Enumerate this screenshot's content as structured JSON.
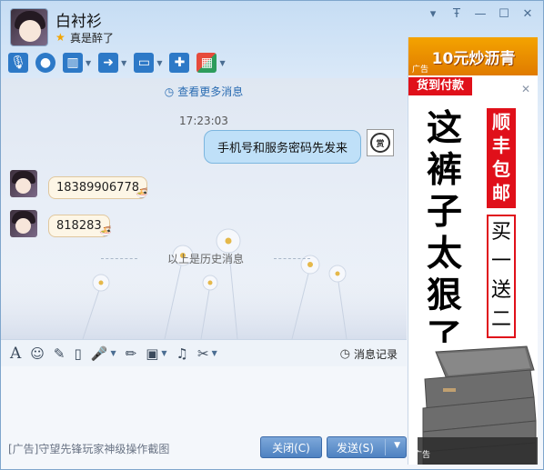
{
  "window": {
    "contact_name": "白衬衫",
    "signature": "真是醉了"
  },
  "toolbar": {
    "items": [
      "microphone",
      "video-camera",
      "presentation",
      "file-transfer",
      "remote-desktop",
      "message",
      "app-grid"
    ]
  },
  "chat": {
    "more_messages": "查看更多消息",
    "timestamp": "17:23:03",
    "outgoing": "手机号和服务密码先发来",
    "incoming": [
      "18389906778",
      "818283"
    ],
    "history_separator": "以上是历史消息"
  },
  "input_toolbar": {
    "history_label": "消息记录"
  },
  "footer": {
    "ad_text": "[广告]守望先锋玩家神级操作截图",
    "close_label": "关闭(C)",
    "send_label": "发送(S)"
  },
  "ad": {
    "banner": "10元炒沥青",
    "banner_tag": "广告",
    "cod": "货到付款",
    "headline": "这裤子太狠了",
    "red_box": "顺丰包邮",
    "outline_box": "买一送二",
    "bottom_tag": "广告"
  },
  "colors": {
    "accent": "#4e82c1",
    "bubble_out": "#bfe0f8",
    "bubble_in": "#fdf6e6",
    "ad_red": "#e0101a",
    "ad_orange": "#f4a300"
  }
}
